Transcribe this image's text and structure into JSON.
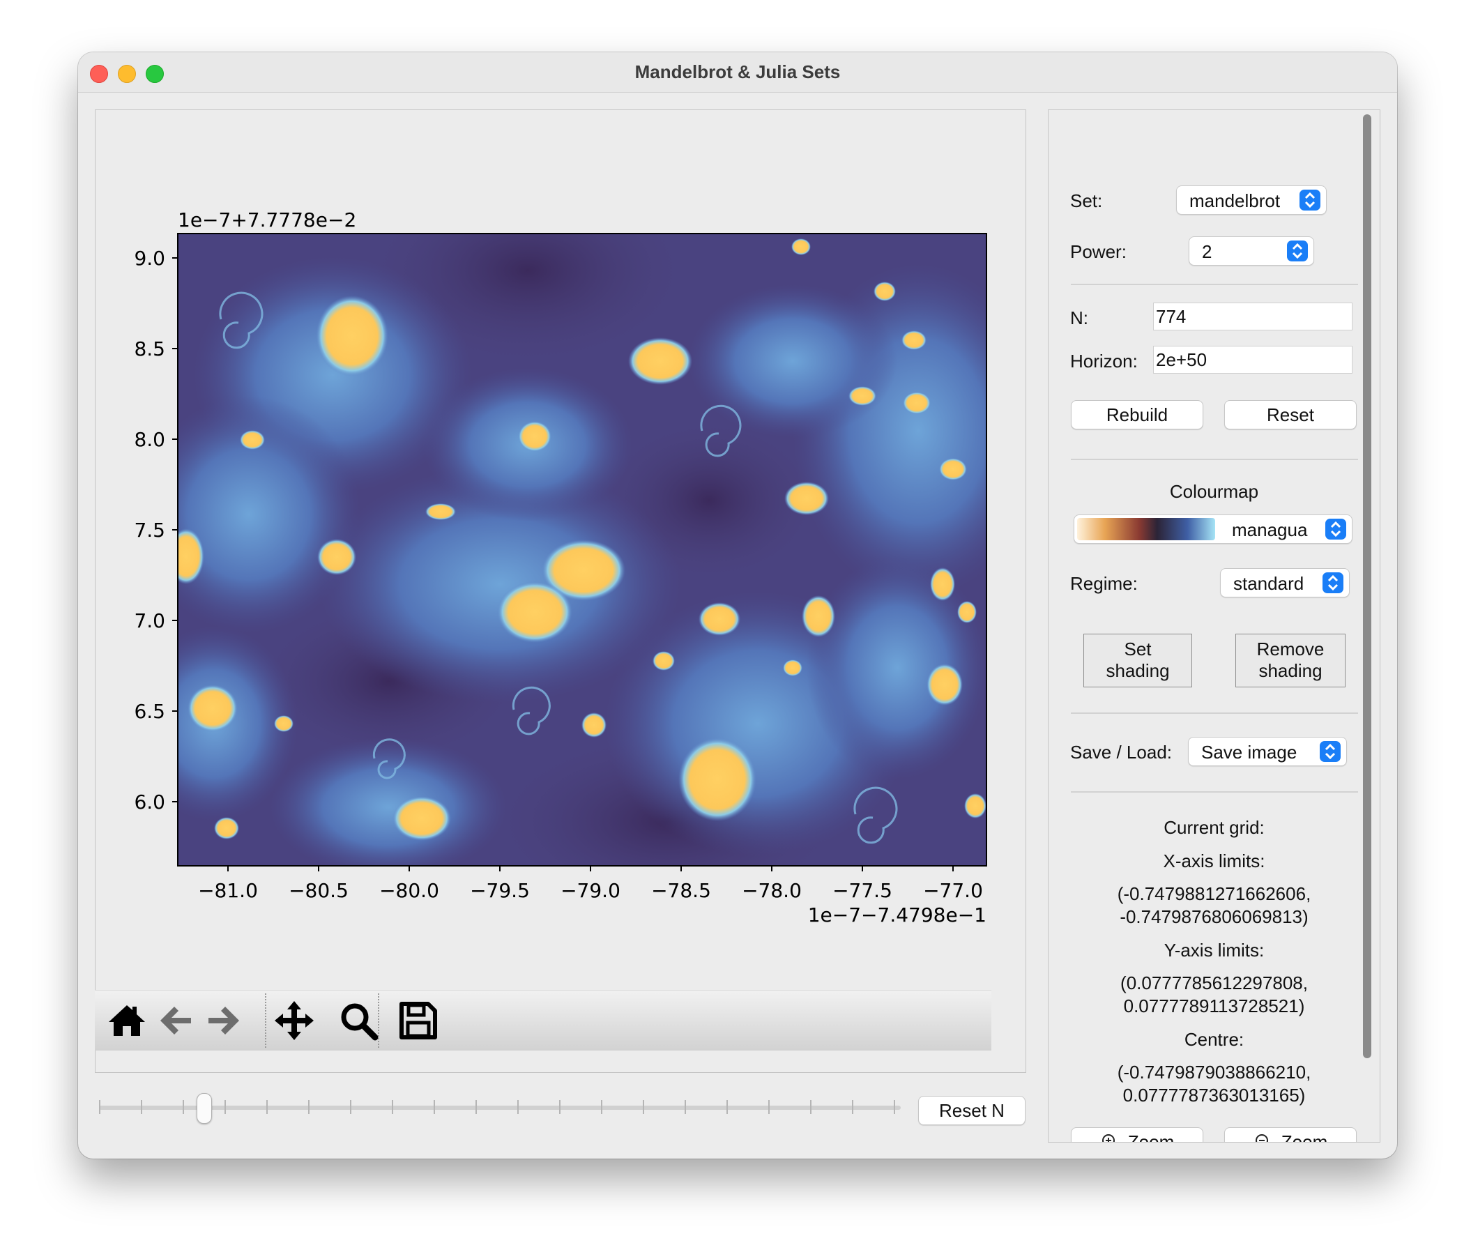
{
  "window": {
    "title": "Mandelbrot & Julia Sets"
  },
  "plot": {
    "offset_top": "1e−7+7.7778e−2",
    "offset_bottom": "1e−7−7.4798e−1",
    "x_ticks": [
      "−81.0",
      "−80.5",
      "−80.0",
      "−79.5",
      "−79.0",
      "−78.5",
      "−78.0",
      "−77.5",
      "−77.0"
    ],
    "y_ticks": [
      "9.0",
      "8.5",
      "8.0",
      "7.5",
      "7.0",
      "6.5",
      "6.0"
    ],
    "colors": {
      "background": "#4a3f78",
      "deep": "#3d2d60",
      "mid": "#4f5fa8",
      "edge": "#7fc4e8",
      "fill": "#fecc5c"
    }
  },
  "toolbar": {
    "icons": [
      "home-icon",
      "back-arrow-icon",
      "forward-arrow-icon",
      "pan-icon",
      "zoom-magnifier-icon",
      "save-disk-icon"
    ]
  },
  "slider": {
    "value_fraction": 0.13
  },
  "reset_n_label": "Reset N",
  "side": {
    "set_label": "Set:",
    "set_value": "mandelbrot",
    "power_label": "Power:",
    "power_value": "2",
    "n_label": "N:",
    "n_value": "774",
    "horizon_label": "Horizon:",
    "horizon_value": "2e+50",
    "rebuild_label": "Rebuild",
    "reset_label": "Reset",
    "colourmap_heading": "Colourmap",
    "colourmap_value": "managua",
    "regime_label": "Regime:",
    "regime_value": "standard",
    "set_shading_line1": "Set",
    "set_shading_line2": "shading",
    "remove_shading_line1": "Remove",
    "remove_shading_line2": "shading",
    "save_load_label": "Save / Load:",
    "save_load_value": "Save image",
    "current_grid_heading": "Current grid:",
    "x_limits_heading": "X-axis limits:",
    "x_limits_line1": "(-0.7479881271662606,",
    "x_limits_line2": "-0.7479876806069813)",
    "y_limits_heading": "Y-axis limits:",
    "y_limits_line1": "(0.0777785612297808,",
    "y_limits_line2": "0.0777789113728521)",
    "centre_heading": "Centre:",
    "centre_line1": "(-0.7479879038866210,",
    "centre_line2": "0.0777787363013165)",
    "zoom_in_label": "Zoom",
    "zoom_out_label": "Zoom"
  }
}
